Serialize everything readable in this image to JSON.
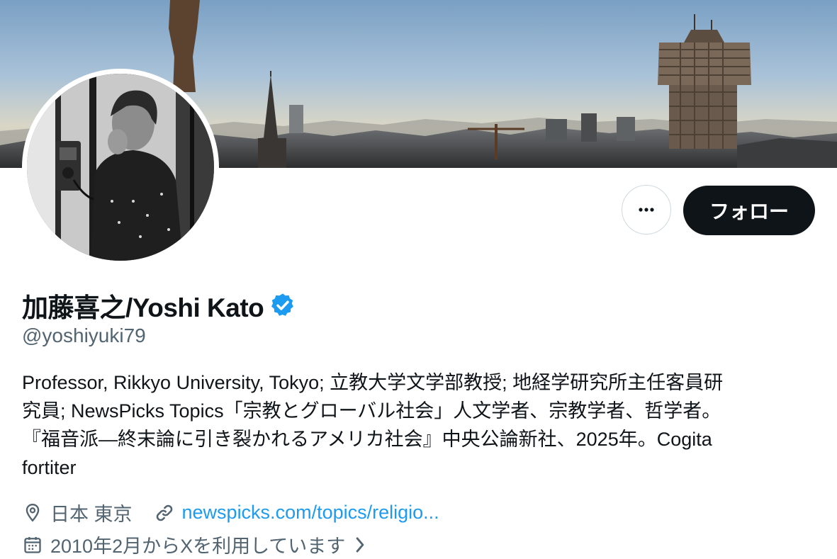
{
  "profile": {
    "display_name": "加藤喜之/Yoshi Kato",
    "handle": "@yoshiyuki79",
    "verified": true,
    "bio_lines": [
      "Professor, Rikkyo University, Tokyo; 立教大学文学部教授; 地経学研究所主任客員研",
      "究員; NewsPicks Topics「宗教とグローバル社会」人文学者、宗教学者、哲学者。",
      "『福音派―終末論に引き裂かれるアメリカ社会』中央公論新社、2025年。Cogita",
      "fortiter"
    ],
    "location": "日本 東京",
    "website": "newspicks.com/topics/religio...",
    "joined": "2010年2月からXを利用しています"
  },
  "actions": {
    "more_label": "…",
    "follow_label": "フォロー"
  },
  "icons": {
    "verified": "verified-badge-icon",
    "more": "more-dots-icon",
    "location": "location-pin-icon",
    "link": "link-icon",
    "calendar": "calendar-icon",
    "chevron": "chevron-right-icon"
  },
  "colors": {
    "accent": "#1d9bf0",
    "text_primary": "#0f1419",
    "text_secondary": "#536471",
    "follow_bg": "#0f1419",
    "border": "#cfd9de"
  }
}
